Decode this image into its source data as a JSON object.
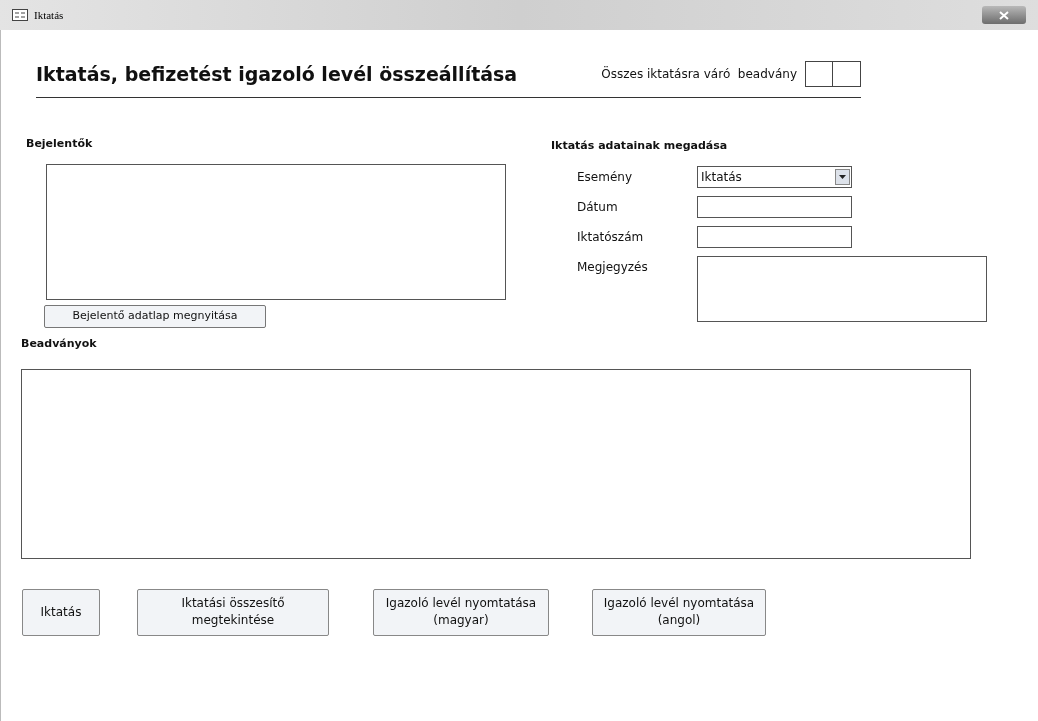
{
  "window": {
    "title": "Iktatás"
  },
  "header": {
    "title": "Iktatás, befizetést igazoló levél összeállítása",
    "counter_label": "Összes iktatásra váró  beadvány"
  },
  "bejelentok": {
    "label": "Bejelentők",
    "button": "Bejelentő adatlap megnyitása"
  },
  "iktatas_adatai": {
    "label": "Iktatás adatainak megadása",
    "fields": [
      {
        "kind": "dropdown",
        "label": "Esemény",
        "value": "Iktatás"
      },
      {
        "kind": "text",
        "label": "Dátum"
      },
      {
        "kind": "text",
        "label": "Iktatószám"
      },
      {
        "kind": "memo",
        "label": "Megjegyzés"
      }
    ]
  },
  "beadvanyok": {
    "label": "Beadványok"
  },
  "buttons": [
    "Iktatás",
    "Iktatási összesítő megtekintése",
    "Igazoló levél nyomtatása (magyar)",
    "Igazoló levél nyomtatása (angol)"
  ]
}
